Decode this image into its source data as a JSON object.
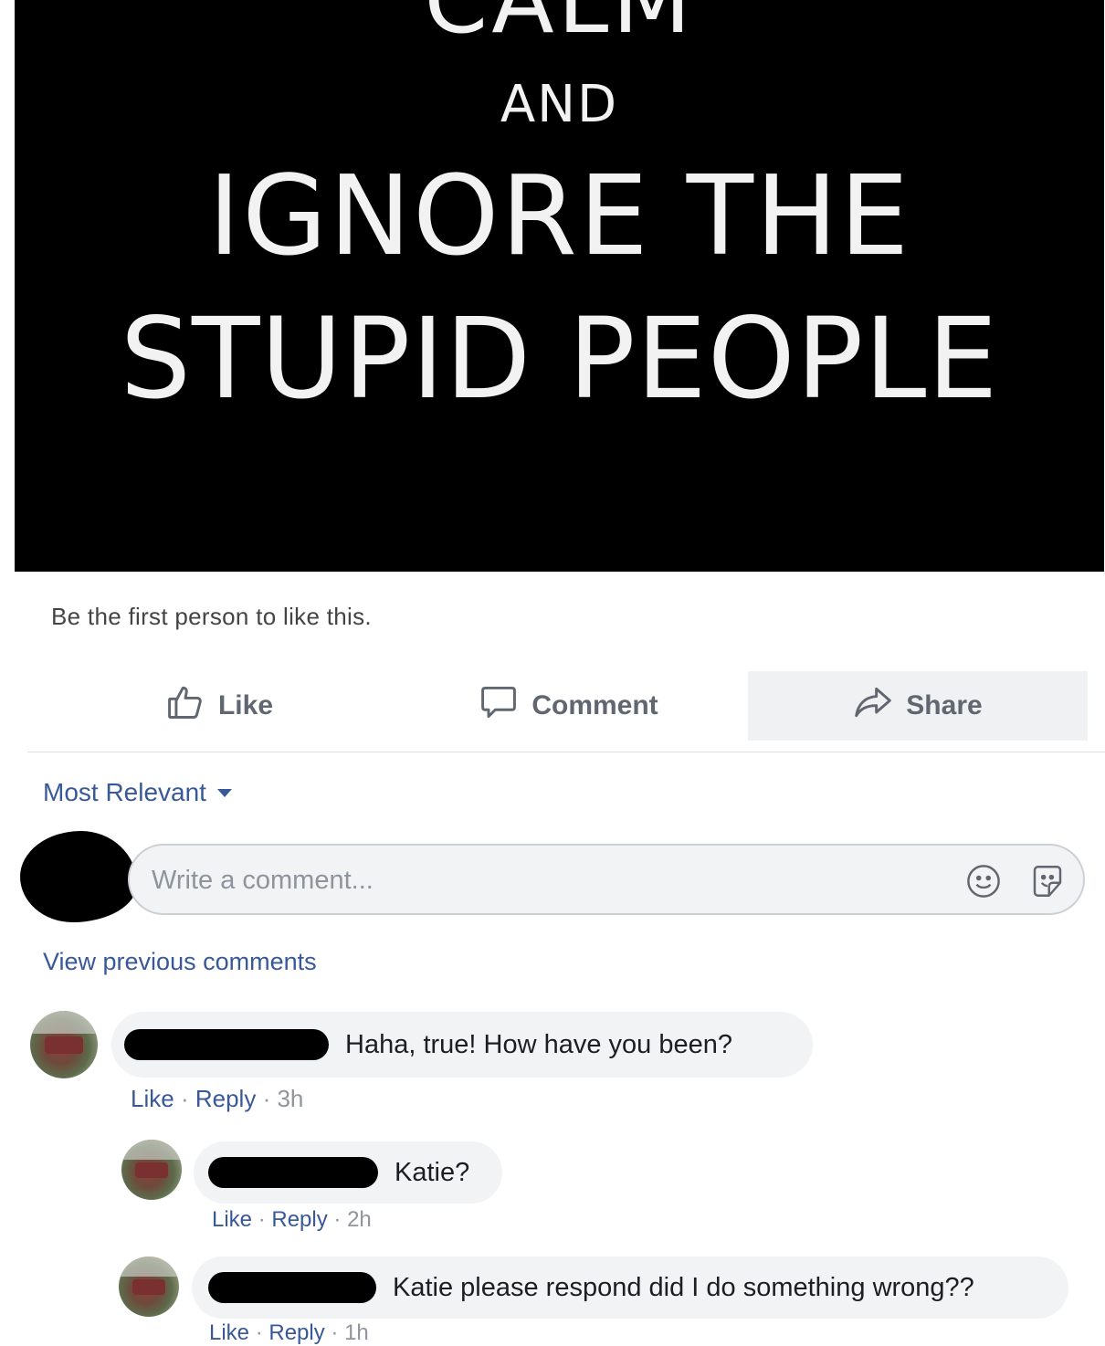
{
  "poster": {
    "line_top": "CALM",
    "line_and": "AND",
    "line_ignore": "IGNORE THE",
    "line_stupid": "STUPID PEOPLE"
  },
  "likes_text": "Be the first person to like this.",
  "actions": {
    "like": "Like",
    "comment": "Comment",
    "share": "Share"
  },
  "sort_label": "Most Relevant",
  "comment_input": {
    "placeholder": "Write a comment..."
  },
  "view_previous": "View previous comments",
  "meta_separator": "·",
  "comments": [
    {
      "text": "Haha, true! How have you been?",
      "like": "Like",
      "reply": "Reply",
      "time": "3h"
    },
    {
      "text": "Katie?",
      "like": "Like",
      "reply": "Reply",
      "time": "2h"
    },
    {
      "text": "Katie please respond did I do something wrong??",
      "like": "Like",
      "reply": "Reply",
      "time": "1h"
    }
  ],
  "colors": {
    "link": "#385898",
    "muted": "#90949c",
    "bubble": "#f2f3f5",
    "action_text": "#606770"
  },
  "icons": {
    "like": "thumbs-up-icon",
    "comment": "speech-bubble-icon",
    "share": "share-arrow-icon",
    "emoji": "smiley-icon",
    "sticker": "sticker-icon"
  }
}
